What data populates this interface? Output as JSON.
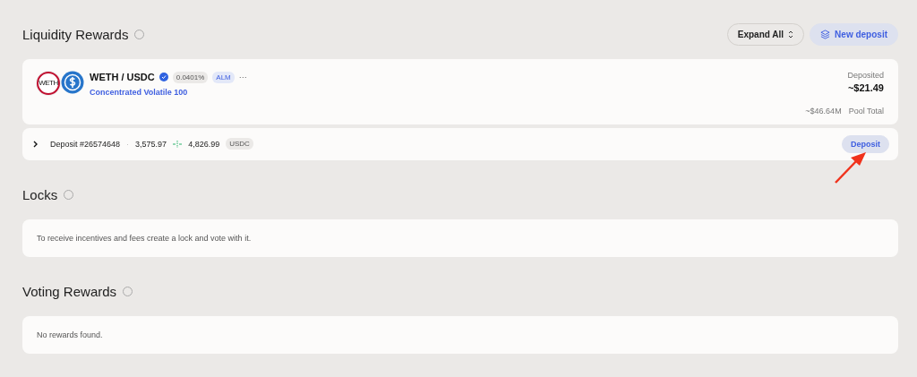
{
  "liquidity": {
    "title": "Liquidity Rewards",
    "expand_button": "Expand All",
    "new_deposit_button": "New deposit",
    "pool": {
      "pair": "WETH / USDC",
      "verified": true,
      "fee": "0.0401%",
      "tag": "ALM",
      "more": "···",
      "type": "Concentrated Volatile 100",
      "deposited_label": "Deposited",
      "deposited_value": "~$21.49",
      "pool_total_value": "~$46.64M",
      "pool_total_label": "Pool Total",
      "token_a_label": "WETH"
    },
    "deposits": [
      {
        "expanded": false,
        "name": "Deposit #26574648",
        "separator": "·",
        "amount_a": "3,575.97",
        "amount_b": "4,826.99",
        "token": "USDC",
        "button": "Deposit"
      }
    ]
  },
  "locks": {
    "title": "Locks",
    "message": "To receive incentives and fees create a lock and vote with it."
  },
  "voting": {
    "title": "Voting Rewards",
    "message": "No rewards found."
  }
}
